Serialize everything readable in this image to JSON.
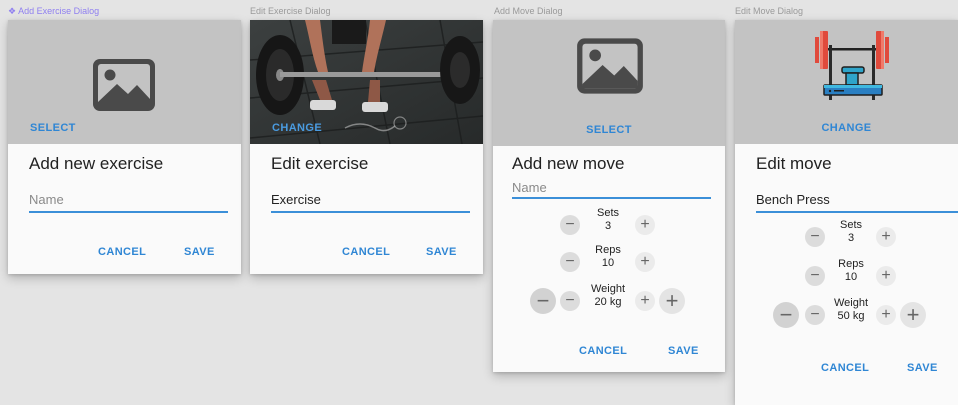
{
  "frames": [
    {
      "label": "Add Exercise Dialog",
      "media_button": "SELECT",
      "media_icon": "image-placeholder-icon",
      "title": "Add new exercise",
      "field_placeholder": "Name",
      "cancel": "CANCEL",
      "save": "SAVE"
    },
    {
      "label": "Edit Exercise Dialog",
      "media_button": "CHANGE",
      "media_icon": "barbell-deadlift-photo",
      "title": "Edit exercise",
      "field_value": "Exercise",
      "cancel": "CANCEL",
      "save": "SAVE"
    },
    {
      "label": "Add Move Dialog",
      "media_button": "SELECT",
      "media_icon": "image-placeholder-icon",
      "title": "Add new move",
      "field_placeholder": "Name",
      "steppers": {
        "sets": {
          "label": "Sets",
          "value": "3"
        },
        "reps": {
          "label": "Reps",
          "value": "10"
        },
        "weight": {
          "label": "Weight",
          "value": "20 kg"
        }
      },
      "cancel": "CANCEL",
      "save": "SAVE"
    },
    {
      "label": "Edit Move Dialog",
      "media_button": "CHANGE",
      "media_icon": "bench-press-icon",
      "title": "Edit move",
      "field_value": "Bench Press",
      "steppers": {
        "sets": {
          "label": "Sets",
          "value": "3"
        },
        "reps": {
          "label": "Reps",
          "value": "10"
        },
        "weight": {
          "label": "Weight",
          "value": "50 kg"
        }
      },
      "cancel": "CANCEL",
      "save": "SAVE"
    }
  ],
  "colors": {
    "accent": "#2f86d4",
    "selection": "#8f7ff0",
    "media_bg": "#c3c3c3"
  }
}
